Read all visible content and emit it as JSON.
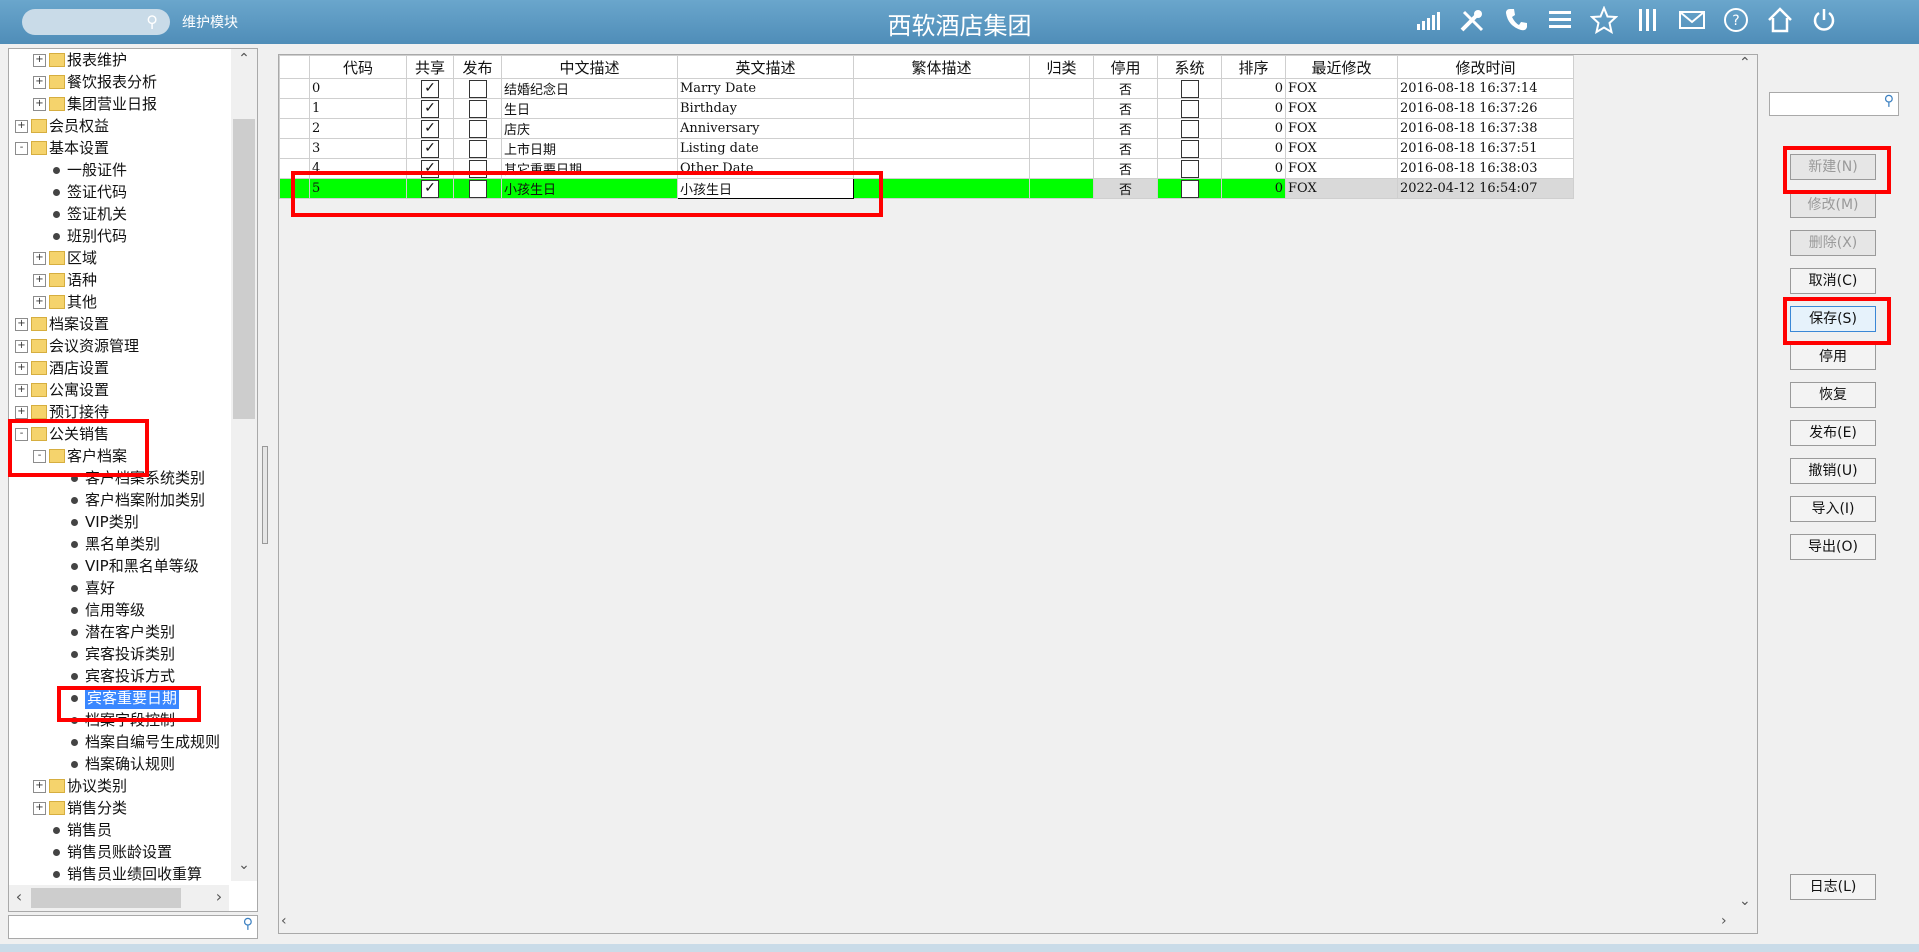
{
  "header": {
    "module_label": "维护模块",
    "app_title": "西软酒店集团",
    "icons": [
      "signal-icon",
      "tools-icon",
      "phone-icon",
      "menu-icon",
      "star-icon",
      "columns-icon",
      "mail-icon",
      "help-icon",
      "home-icon",
      "power-icon"
    ]
  },
  "tree": {
    "items": [
      {
        "level": 1,
        "type": "folder",
        "label": "报表维护",
        "expander": "+"
      },
      {
        "level": 1,
        "type": "folder",
        "label": "餐饮报表分析",
        "expander": "+"
      },
      {
        "level": 1,
        "type": "folder",
        "label": "集团营业日报",
        "expander": "+"
      },
      {
        "level": 0,
        "type": "folder",
        "label": "会员权益",
        "expander": "+"
      },
      {
        "level": 0,
        "type": "folder",
        "label": "基本设置",
        "expander": "-"
      },
      {
        "level": 1,
        "type": "leaf",
        "label": "一般证件"
      },
      {
        "level": 1,
        "type": "leaf",
        "label": "签证代码"
      },
      {
        "level": 1,
        "type": "leaf",
        "label": "签证机关"
      },
      {
        "level": 1,
        "type": "leaf",
        "label": "班别代码"
      },
      {
        "level": 1,
        "type": "folder",
        "label": "区域",
        "expander": "+"
      },
      {
        "level": 1,
        "type": "folder",
        "label": "语种",
        "expander": "+"
      },
      {
        "level": 1,
        "type": "folder",
        "label": "其他",
        "expander": "+"
      },
      {
        "level": 0,
        "type": "folder",
        "label": "档案设置",
        "expander": "+"
      },
      {
        "level": 0,
        "type": "folder",
        "label": "会议资源管理",
        "expander": "+"
      },
      {
        "level": 0,
        "type": "folder",
        "label": "酒店设置",
        "expander": "+"
      },
      {
        "level": 0,
        "type": "folder",
        "label": "公寓设置",
        "expander": "+"
      },
      {
        "level": 0,
        "type": "folder",
        "label": "预订接待",
        "expander": "+"
      },
      {
        "level": 0,
        "type": "folder",
        "label": "公关销售",
        "expander": "-"
      },
      {
        "level": 1,
        "type": "folder",
        "label": "客户档案",
        "expander": "-"
      },
      {
        "level": 2,
        "type": "leaf",
        "label": "客户档案系统类别"
      },
      {
        "level": 2,
        "type": "leaf",
        "label": "客户档案附加类别"
      },
      {
        "level": 2,
        "type": "leaf",
        "label": "VIP类别"
      },
      {
        "level": 2,
        "type": "leaf",
        "label": "黑名单类别"
      },
      {
        "level": 2,
        "type": "leaf",
        "label": "VIP和黑名单等级"
      },
      {
        "level": 2,
        "type": "leaf",
        "label": "喜好"
      },
      {
        "level": 2,
        "type": "leaf",
        "label": "信用等级"
      },
      {
        "level": 2,
        "type": "leaf",
        "label": "潜在客户类别"
      },
      {
        "level": 2,
        "type": "leaf",
        "label": "宾客投诉类别"
      },
      {
        "level": 2,
        "type": "leaf",
        "label": "宾客投诉方式"
      },
      {
        "level": 2,
        "type": "leaf",
        "label": "宾客重要日期",
        "selected": true
      },
      {
        "level": 2,
        "type": "leaf",
        "label": "档案字段控制"
      },
      {
        "level": 2,
        "type": "leaf",
        "label": "档案自编号生成规则"
      },
      {
        "level": 2,
        "type": "leaf",
        "label": "档案确认规则"
      },
      {
        "level": 1,
        "type": "folder",
        "label": "协议类别",
        "expander": "+"
      },
      {
        "level": 1,
        "type": "folder",
        "label": "销售分类",
        "expander": "+"
      },
      {
        "level": 1,
        "type": "leaf",
        "label": "销售员"
      },
      {
        "level": 1,
        "type": "leaf",
        "label": "销售员账龄设置"
      },
      {
        "level": 1,
        "type": "leaf",
        "label": "销售员业绩回收重算"
      }
    ]
  },
  "grid": {
    "columns": [
      "代码",
      "共享",
      "发布",
      "中文描述",
      "英文描述",
      "繁体描述",
      "归类",
      "停用",
      "系统",
      "排序",
      "最近修改",
      "修改时间"
    ],
    "rows": [
      {
        "code": "0",
        "share": true,
        "publish": false,
        "cn": "结婚纪念日",
        "en": "Marry Date",
        "tw": "",
        "cat": "",
        "disabled": "否",
        "system": false,
        "sort": "0",
        "modified_by": "FOX",
        "modified_at": "2016-08-18 16:37:14"
      },
      {
        "code": "1",
        "share": true,
        "publish": false,
        "cn": "生日",
        "en": "Birthday",
        "tw": "",
        "cat": "",
        "disabled": "否",
        "system": false,
        "sort": "0",
        "modified_by": "FOX",
        "modified_at": "2016-08-18 16:37:26"
      },
      {
        "code": "2",
        "share": true,
        "publish": false,
        "cn": "店庆",
        "en": "Anniversary",
        "tw": "",
        "cat": "",
        "disabled": "否",
        "system": false,
        "sort": "0",
        "modified_by": "FOX",
        "modified_at": "2016-08-18 16:37:38"
      },
      {
        "code": "3",
        "share": true,
        "publish": false,
        "cn": "上市日期",
        "en": "Listing date",
        "tw": "",
        "cat": "",
        "disabled": "否",
        "system": false,
        "sort": "0",
        "modified_by": "FOX",
        "modified_at": "2016-08-18 16:37:51"
      },
      {
        "code": "4",
        "share": true,
        "publish": false,
        "cn": "其它重要日期",
        "en": "Other Date",
        "tw": "",
        "cat": "",
        "disabled": "否",
        "system": false,
        "sort": "0",
        "modified_by": "FOX",
        "modified_at": "2016-08-18 16:38:03"
      },
      {
        "code": "5",
        "share": true,
        "publish": false,
        "cn": "小孩生日",
        "en": "小孩生日",
        "tw": "",
        "cat": "",
        "disabled": "否",
        "system": false,
        "sort": "0",
        "modified_by": "FOX",
        "modified_at": "2022-04-12 16:54:07",
        "new": true
      }
    ]
  },
  "buttons": [
    {
      "name": "new-button",
      "label": "新建(N)",
      "state": "disabled"
    },
    {
      "name": "modify-button",
      "label": "修改(M)",
      "state": "disabled"
    },
    {
      "name": "delete-button",
      "label": "删除(X)",
      "state": "disabled"
    },
    {
      "name": "cancel-button",
      "label": "取消(C)",
      "state": "normal"
    },
    {
      "name": "save-button",
      "label": "保存(S)",
      "state": "active"
    },
    {
      "name": "disable-button",
      "label": "停用",
      "state": "normal"
    },
    {
      "name": "restore-button",
      "label": "恢复",
      "state": "normal"
    },
    {
      "name": "publish-button",
      "label": "发布(E)",
      "state": "normal"
    },
    {
      "name": "revoke-button",
      "label": "撤销(U)",
      "state": "normal"
    },
    {
      "name": "import-button",
      "label": "导入(I)",
      "state": "normal"
    },
    {
      "name": "export-button",
      "label": "导出(O)",
      "state": "normal"
    }
  ],
  "log_button": {
    "label": "日志(L)"
  },
  "colors": {
    "titlebar": "#5a97c2",
    "new_row": "#00ff00",
    "highlight": "#ff0000",
    "selection": "#3a87ff"
  }
}
